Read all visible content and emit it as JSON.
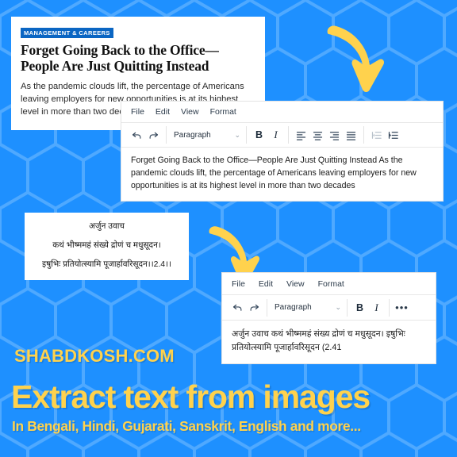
{
  "background": {
    "base_color": "#1e90ff",
    "pattern_color": "#4aa8ff",
    "pattern": "hexagon-honeycomb"
  },
  "accent_color": "#ffd24d",
  "news_card": {
    "kicker": "MANAGEMENT & CAREERS",
    "headline": "Forget Going Back to the Office—People Are Just Quitting Instead",
    "dek": "As the pandemic clouds lift, the percentage of Americans leaving employers for new opportunities is at its highest level in more than two decades"
  },
  "editor_english": {
    "menu": [
      "File",
      "Edit",
      "View",
      "Format"
    ],
    "toolbar": {
      "undo": "undo-icon",
      "redo": "redo-icon",
      "style_value": "Paragraph",
      "style_chevron": "⌄",
      "bold": "B",
      "italic": "I",
      "align_left": "align-left-icon",
      "align_center": "align-center-icon",
      "align_right": "align-right-icon",
      "align_justify": "align-justify-icon",
      "outdent": "outdent-icon",
      "indent": "indent-icon"
    },
    "content": "Forget Going Back to the Office—People Are Just Quitting Instead As the pandemic clouds lift, the percentage of Americans leaving employers for new opportunities is at its highest level in more than two decades"
  },
  "sanskrit_card": {
    "lines": [
      "अर्जुन उवाच",
      "कथं भीष्ममहं संख्ये द्रोणं च मधुसूदन।",
      "इषुभिः प्रतियोत्स्यामि पूजार्हावरिसूदन।।2.4।।"
    ]
  },
  "editor_sanskrit": {
    "menu": [
      "File",
      "Edit",
      "View",
      "Format"
    ],
    "toolbar": {
      "undo": "undo-icon",
      "redo": "redo-icon",
      "style_value": "Paragraph",
      "style_chevron": "⌄",
      "bold": "B",
      "italic": "I",
      "more": "•••"
    },
    "content": "अर्जुन उवाच कथं भीष्ममहं संख्य द्रोणं च मधुसूदन। इषुभिः प्रतियोत्स्यामि पूजार्हावरिसूदन (2.41"
  },
  "arrows": [
    {
      "name": "arrow-top",
      "direction": "curved-down-right"
    },
    {
      "name": "arrow-mid",
      "direction": "curved-down-right"
    }
  ],
  "branding": {
    "site": "SHABDKOSH.COM",
    "headline": "Extract text from images",
    "subline": "In Bengali, Hindi, Gujarati, Sanskrit, English and more..."
  }
}
